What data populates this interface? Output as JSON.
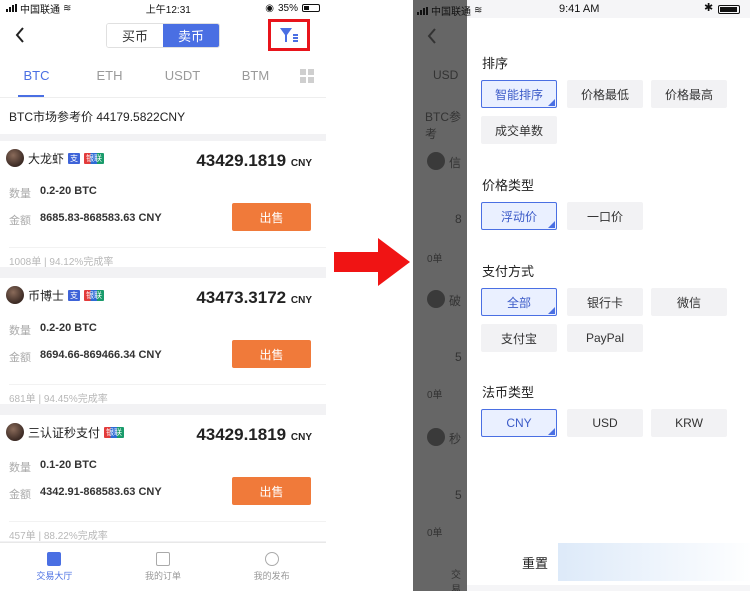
{
  "left": {
    "status": {
      "carrier": "中国联通",
      "time": "上午12:31",
      "battery": "35%"
    },
    "nav": {
      "buy": "买币",
      "sell": "卖币"
    },
    "tabs": [
      "BTC",
      "ETH",
      "USDT",
      "BTM"
    ],
    "reference_price": "BTC市场参考价 44179.5822CNY",
    "cards": [
      {
        "name": "大龙虾",
        "badges": [
          "支",
          "银联"
        ],
        "price": "43429.1819",
        "currency": "CNY",
        "qty_label": "数量",
        "qty": "0.2-20 BTC",
        "amt_label": "金额",
        "amt": "8685.83-868583.63 CNY",
        "button": "出售",
        "orders": "1008单",
        "rate": "94.12%完成率"
      },
      {
        "name": "币博士",
        "badges": [
          "支",
          "银联"
        ],
        "price": "43473.3172",
        "currency": "CNY",
        "qty_label": "数量",
        "qty": "0.2-20 BTC",
        "amt_label": "金额",
        "amt": "8694.66-869466.34 CNY",
        "button": "出售",
        "orders": "681单",
        "rate": "94.45%完成率"
      },
      {
        "name": "三认证秒支付",
        "badges": [
          "银联"
        ],
        "price": "43429.1819",
        "currency": "CNY",
        "qty_label": "数量",
        "qty": "0.1-20 BTC",
        "amt_label": "金额",
        "amt": "4342.91-868583.63 CNY",
        "button": "出售",
        "orders": "457单",
        "rate": "88.22%完成率"
      }
    ],
    "bottom_nav": [
      "交易大厅",
      "我的订单",
      "我的发布"
    ]
  },
  "right": {
    "status": {
      "carrier": "中国联通",
      "time": "9:41 AM"
    },
    "dimmed": {
      "usd": "USD",
      "btc": "BTC参考",
      "c1": "信",
      "c2": "破",
      "c3": "秒",
      "n1": "8",
      "n2": "5",
      "n3": "5",
      "l1": "0单",
      "l2": "0单",
      "l3": "0单",
      "trade": "交易"
    },
    "sections": [
      {
        "title": "排序",
        "options": [
          "智能排序",
          "价格最低",
          "价格最高",
          "成交单数"
        ],
        "selected": 0
      },
      {
        "title": "价格类型",
        "options": [
          "浮动价",
          "一口价"
        ],
        "selected": 0
      },
      {
        "title": "支付方式",
        "options": [
          "全部",
          "银行卡",
          "微信",
          "支付宝",
          "PayPal"
        ],
        "selected": 0
      },
      {
        "title": "法币类型",
        "options": [
          "CNY",
          "USD",
          "KRW"
        ],
        "selected": 0
      }
    ],
    "reset": "重置"
  },
  "colors": {
    "accent": "#4a6fe3",
    "sell": "#f07a3a",
    "highlight": "#e8141b",
    "arrow": "#f01414"
  }
}
